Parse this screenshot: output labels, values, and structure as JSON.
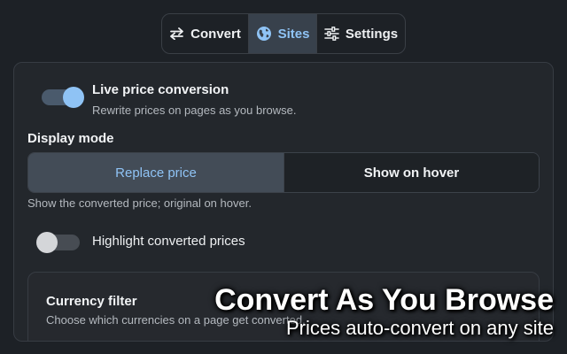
{
  "tabs": [
    {
      "label": "Convert",
      "icon": "swap-arrows-icon"
    },
    {
      "label": "Sites",
      "icon": "globe-icon",
      "active": true
    },
    {
      "label": "Settings",
      "icon": "sliders-icon"
    }
  ],
  "live_conversion": {
    "title": "Live price conversion",
    "description": "Rewrite prices on pages as you browse.",
    "enabled": true
  },
  "display_mode": {
    "label": "Display mode",
    "options": [
      "Replace price",
      "Show on hover"
    ],
    "selected": "Replace price",
    "help": "Show the converted price; original on hover."
  },
  "highlight": {
    "label": "Highlight converted prices",
    "enabled": false
  },
  "currency_filter": {
    "title": "Currency filter",
    "description": "Choose which currencies on a page get converted."
  },
  "promo": {
    "headline": "Convert As You Browse",
    "subline": "Prices auto-convert on any site"
  },
  "colors": {
    "accent": "#8fc3f5",
    "background": "#1d2126",
    "panel": "#23272c"
  }
}
